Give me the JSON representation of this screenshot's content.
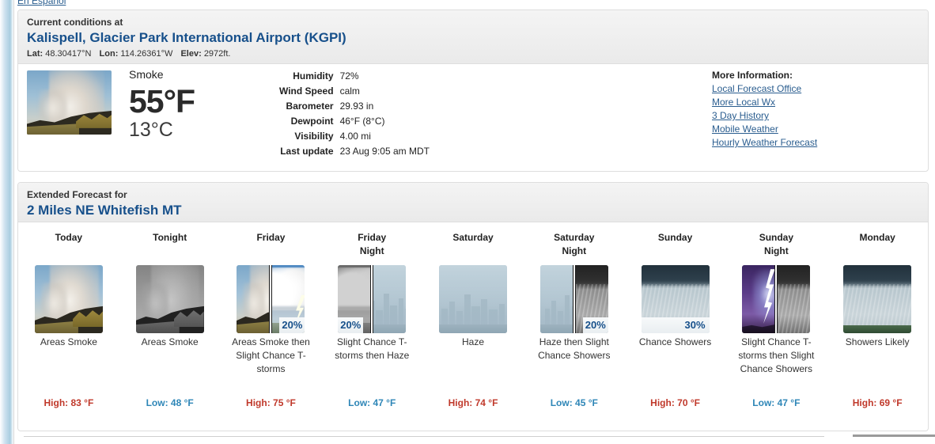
{
  "page": {
    "espanol_link": "En Español"
  },
  "current": {
    "heading_small": "Current conditions at",
    "heading_station": "Kalispell, Glacier Park International Airport (KGPI)",
    "lat_label": "Lat:",
    "lat_value": "48.30417°N",
    "lon_label": "Lon:",
    "lon_value": "114.26361°W",
    "elev_label": "Elev:",
    "elev_value": "2972ft.",
    "condition": "Smoke",
    "temp_f": "55°F",
    "temp_c": "13°C",
    "icon_name": "smoke-plume-photo",
    "observations": [
      {
        "label": "Humidity",
        "value": "72%"
      },
      {
        "label": "Wind Speed",
        "value": "calm"
      },
      {
        "label": "Barometer",
        "value": "29.93 in"
      },
      {
        "label": "Dewpoint",
        "value": "46°F (8°C)"
      },
      {
        "label": "Visibility",
        "value": "4.00 mi"
      },
      {
        "label": "Last update",
        "value": "23 Aug 9:05 am MDT"
      }
    ],
    "more_info_title": "More Information:",
    "more_info_links": [
      "Local Forecast Office",
      "More Local Wx",
      "3 Day History",
      "Mobile Weather",
      "Hourly Weather Forecast"
    ]
  },
  "forecast": {
    "heading_small": "Extended Forecast for",
    "heading_location": "2 Miles NE Whitefish MT",
    "periods": [
      {
        "day": "Today",
        "day_line2": "",
        "desc": "Areas Smoke",
        "temp_label": "High: 83 °F",
        "temp_type": "high",
        "icon": "smoke",
        "pop": ""
      },
      {
        "day": "Tonight",
        "day_line2": "",
        "desc": "Areas Smoke",
        "temp_label": "Low: 48 °F",
        "temp_type": "low",
        "icon": "smoke-night",
        "pop": ""
      },
      {
        "day": "Friday",
        "day_line2": "",
        "desc": "Areas Smoke then Slight Chance T-storms",
        "temp_label": "High: 75 °F",
        "temp_type": "high",
        "icon": "smoke-then-tstorm",
        "pop": "20%"
      },
      {
        "day": "Friday",
        "day_line2": "Night",
        "desc": "Slight Chance T-storms then Haze",
        "temp_label": "Low: 47 °F",
        "temp_type": "low",
        "icon": "tstorm-then-haze",
        "pop": "20%"
      },
      {
        "day": "Saturday",
        "day_line2": "",
        "desc": "Haze",
        "temp_label": "High: 74 °F",
        "temp_type": "high",
        "icon": "haze",
        "pop": ""
      },
      {
        "day": "Saturday",
        "day_line2": "Night",
        "desc": "Haze then Slight Chance Showers",
        "temp_label": "Low: 45 °F",
        "temp_type": "low",
        "icon": "haze-then-showers",
        "pop": "20%"
      },
      {
        "day": "Sunday",
        "day_line2": "",
        "desc": "Chance Showers",
        "temp_label": "High: 70 °F",
        "temp_type": "high",
        "icon": "showers",
        "pop": "30%"
      },
      {
        "day": "Sunday",
        "day_line2": "Night",
        "desc": "Slight Chance T-storms then Slight Chance Showers",
        "temp_label": "Low: 47 °F",
        "temp_type": "low",
        "icon": "lightning-then-showers",
        "pop": ""
      },
      {
        "day": "Monday",
        "day_line2": "",
        "desc": "Showers Likely",
        "temp_label": "High: 69 °F",
        "temp_type": "high",
        "icon": "showers-likely",
        "pop": ""
      }
    ]
  },
  "colors": {
    "link": "#2a5d8f",
    "heading_blue": "#17508b",
    "high_temp": "#c0392b",
    "low_temp": "#2e86b7",
    "panel_border": "#dedede",
    "panel_head_bg": "#eeeeee"
  }
}
